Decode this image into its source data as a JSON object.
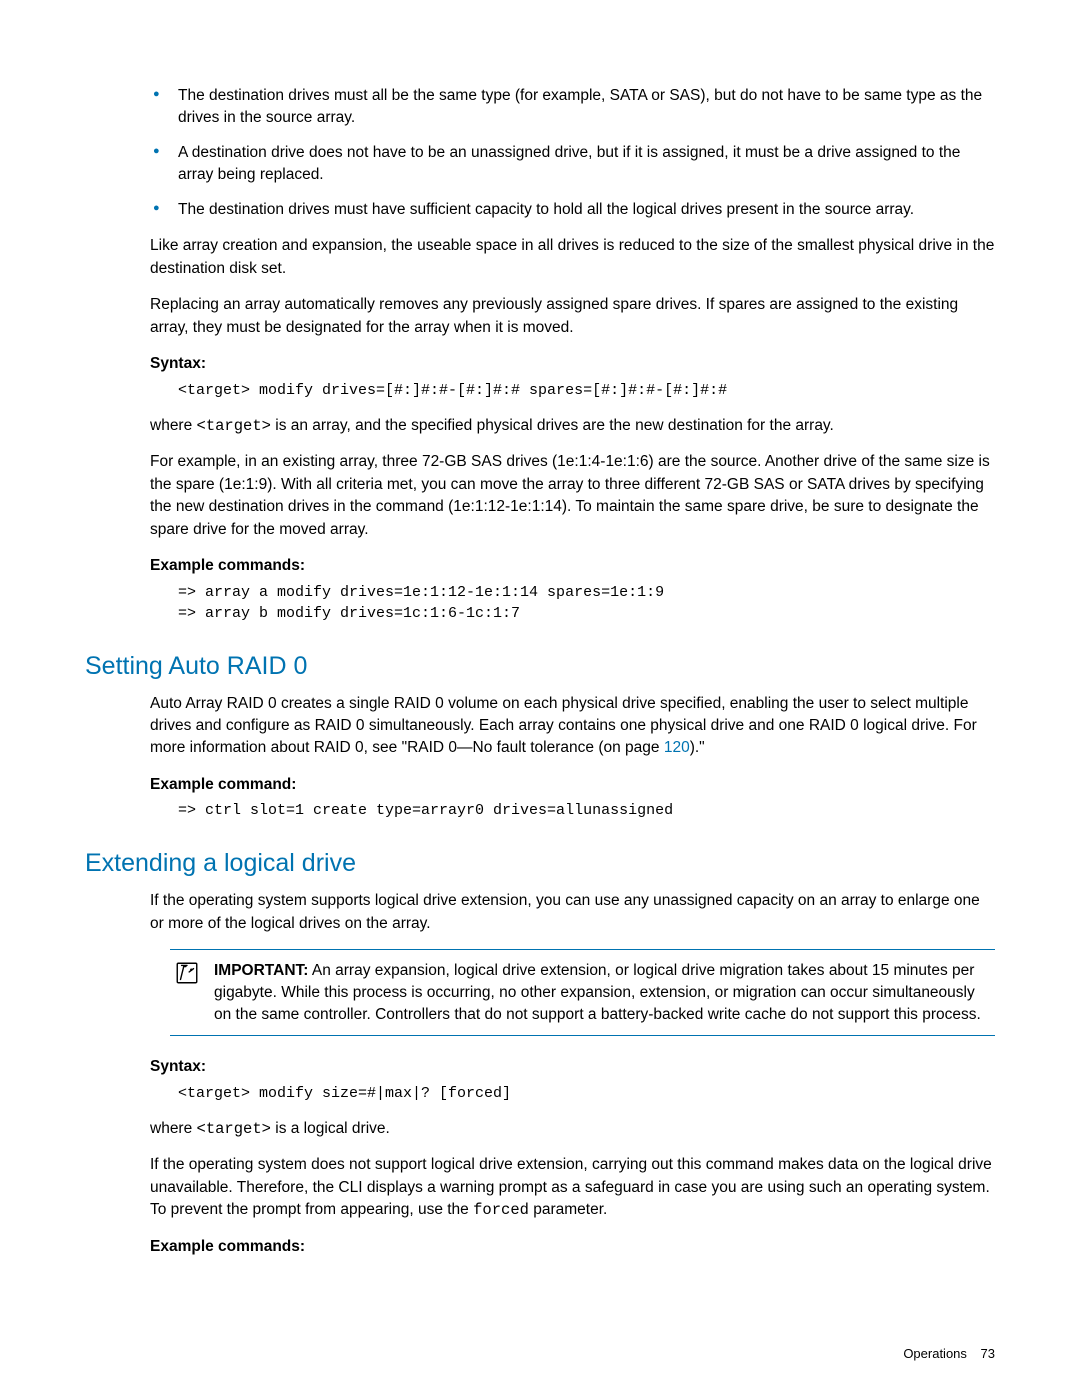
{
  "bullets": {
    "b1": "The destination drives must all be the same type (for example, SATA or SAS), but do not have to be same type as the drives in the source array.",
    "b2": "A destination drive does not have to be an unassigned drive, but if it is assigned, it must be a drive assigned to the array being replaced.",
    "b3": "The destination drives must have sufficient capacity to hold all the logical drives present in the source array."
  },
  "intro": {
    "p1": "Like array creation and expansion, the useable space in all drives is reduced to the size of the smallest physical drive in the destination disk set.",
    "p2": "Replacing an array automatically removes any previously assigned spare drives. If spares are assigned to the existing array, they must be designated for the array when it is moved."
  },
  "syntax1": {
    "label": "Syntax:",
    "code": "<target> modify drives=[#:]#:#-[#:]#:# spares=[#:]#:#-[#:]#:#",
    "where_a": "where ",
    "where_code": "<target>",
    "where_b": " is an array, and the specified physical drives are the new destination for the array."
  },
  "example_para": "For example, in an existing array, three 72-GB SAS drives (1e:1:4-1e:1:6) are the source. Another drive of the same size is the spare (1e:1:9). With all criteria met, you can move the array to three different 72-GB SAS or SATA drives by specifying the new destination drives in the command (1e:1:12-1e:1:14). To maintain the same spare drive, be sure to designate the spare drive for the moved array.",
  "ex1": {
    "label": "Example commands:",
    "code": "=> array a modify drives=1e:1:12-1e:1:14 spares=1e:1:9\n=> array b modify drives=1c:1:6-1c:1:7"
  },
  "section1": {
    "title": "Setting Auto RAID 0",
    "p_a": "Auto Array RAID 0 creates a single RAID 0 volume on each physical drive specified, enabling the user to select multiple drives and configure as RAID 0 simultaneously. Each array contains one physical drive and one RAID 0 logical drive. For more information about RAID 0, see \"RAID 0—No fault tolerance (on page ",
    "link": "120",
    "p_b": ").\"",
    "ex_label": "Example command:",
    "ex_code": "=> ctrl slot=1 create type=arrayr0 drives=allunassigned"
  },
  "section2": {
    "title": "Extending a logical drive",
    "p1": "If the operating system supports logical drive extension, you can use any unassigned capacity on an array to enlarge one or more of the logical drives on the array.",
    "important_label": "IMPORTANT:",
    "important_text": "   An array expansion, logical drive extension, or logical drive migration takes about 15 minutes per gigabyte. While this process is occurring, no other expansion, extension, or migration can occur simultaneously on the same controller. Controllers that do not support a battery-backed write cache do not support this process.",
    "syntax_label": "Syntax:",
    "syntax_code": "<target> modify size=#|max|? [forced]",
    "where_a": "where ",
    "where_code": "<target>",
    "where_b": " is a logical drive.",
    "p2_a": "If the operating system does not support logical drive extension, carrying out this command makes data on the logical drive unavailable. Therefore, the CLI displays a warning prompt as a safeguard in case you are using such an operating system. To prevent the prompt from appearing, use the ",
    "p2_code": "forced",
    "p2_b": " parameter.",
    "ex_label": "Example commands:"
  },
  "footer": {
    "section": "Operations",
    "page": "73"
  }
}
